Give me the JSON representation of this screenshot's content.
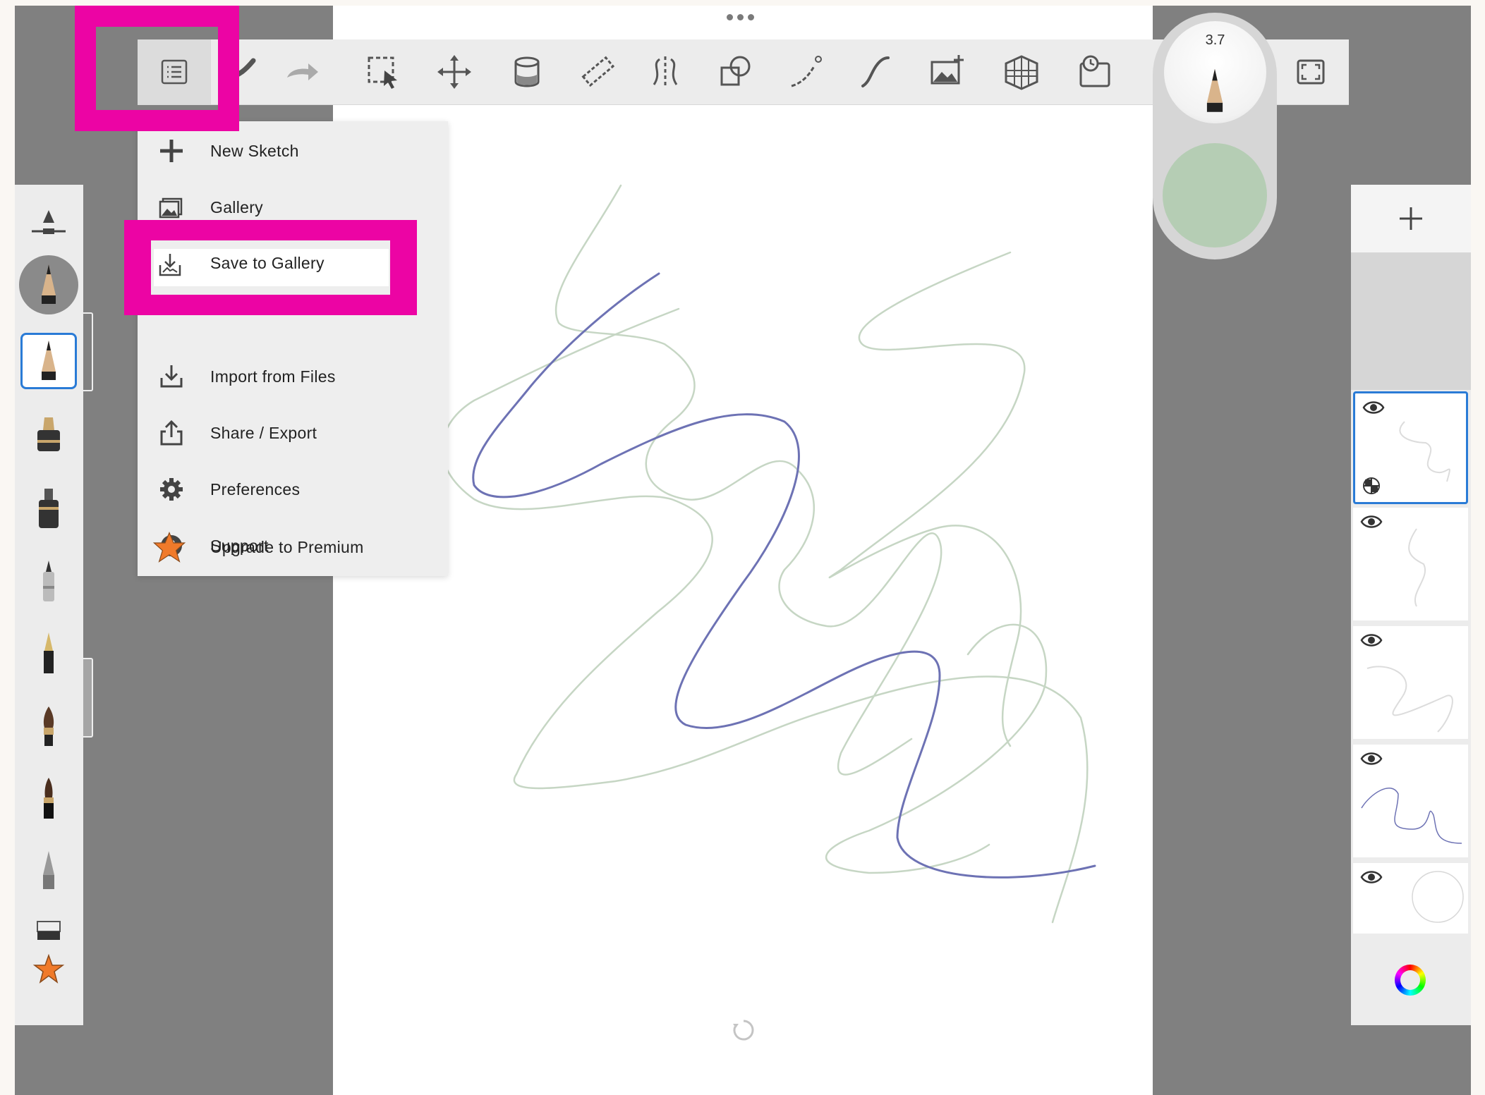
{
  "menu": {
    "items": [
      {
        "label": "New Sketch",
        "icon": "plus-icon"
      },
      {
        "label": "Gallery",
        "icon": "gallery-icon"
      },
      {
        "label": "Save to Gallery",
        "icon": "save-to-gallery-icon"
      },
      {
        "label": "Import from Files",
        "icon": "import-icon"
      },
      {
        "label": "Share / Export",
        "icon": "share-icon"
      },
      {
        "label": "Preferences",
        "icon": "gear-icon"
      },
      {
        "label": "Support",
        "icon": "help-icon"
      },
      {
        "label": "Upgrade to Premium",
        "icon": "star-icon"
      }
    ]
  },
  "brush": {
    "size": "3.7"
  },
  "colors": {
    "highlight": "#ec04a4",
    "current_color": "#b5cdb4",
    "stroke_blue": "#6d72b4",
    "stroke_green": "#c6d6c4",
    "premium_star": "#f07a2a"
  },
  "toolbar": {
    "tools": [
      "menu-icon",
      "undo-icon",
      "redo-icon",
      "selection-icon",
      "transform-icon",
      "fill-icon",
      "ruler-icon",
      "symmetry-icon",
      "shapes-icon",
      "curve-icon",
      "stroke-icon",
      "add-image-icon",
      "perspective-icon",
      "time-lapse-icon",
      "fullscreen-icon"
    ]
  }
}
